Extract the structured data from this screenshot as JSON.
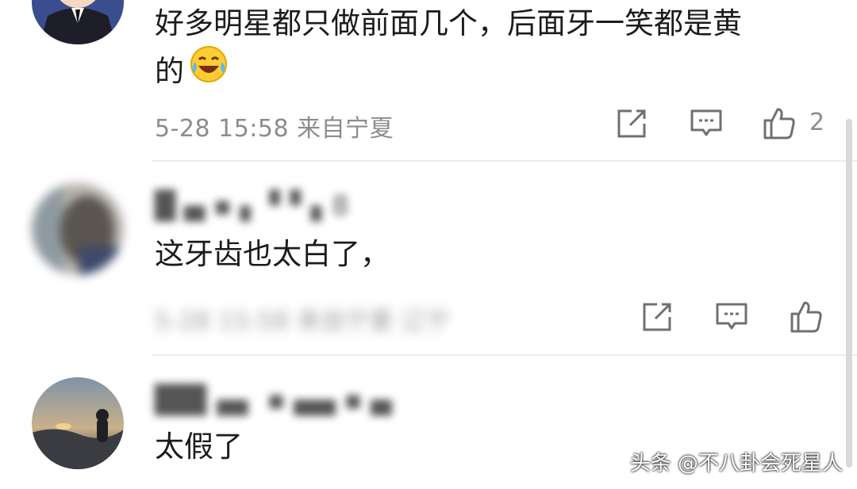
{
  "comments": [
    {
      "username": "",
      "text_line1": "好多明星都只做前面几个，后面牙一笑都是黄",
      "text_line2": "的",
      "emoji": "laughing-crying-emoji",
      "meta": "5-28 15:58 来自宁夏",
      "like_count": "2"
    },
    {
      "username": "█ ▄ ▪ ▖ ▘▘▖8",
      "text": "这牙齿也太白了，",
      "meta": "5-28 15:58 来自宁夏 辽宁",
      "like_count": ""
    },
    {
      "username": "██▌▄▖ ▪  ▄▄ ▪ ▄",
      "text": "太假了",
      "meta": "",
      "like_count": ""
    }
  ],
  "icons": {
    "share": "share-icon",
    "comment": "comment-icon",
    "like": "thumbs-up-icon"
  },
  "watermark": "头条 @不八卦会死星人",
  "colors": {
    "text": "#1b1b1b",
    "meta": "#8c8c8c",
    "icon": "#707070",
    "divider": "#ececec"
  }
}
